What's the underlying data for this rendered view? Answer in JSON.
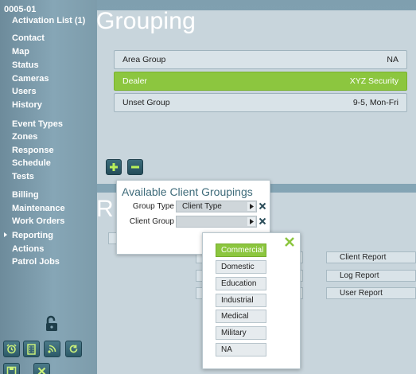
{
  "sidebar": {
    "account_id": "0005-01",
    "items": [
      {
        "label": "Activation List (1)"
      },
      {
        "label": "Contact"
      },
      {
        "label": "Map"
      },
      {
        "label": "Status"
      },
      {
        "label": "Cameras"
      },
      {
        "label": "Users"
      },
      {
        "label": "History"
      },
      {
        "label": "Event Types"
      },
      {
        "label": "Zones"
      },
      {
        "label": "Response"
      },
      {
        "label": "Schedule"
      },
      {
        "label": "Tests"
      },
      {
        "label": "Billing"
      },
      {
        "label": "Maintenance"
      },
      {
        "label": "Work Orders"
      },
      {
        "label": "Reporting"
      },
      {
        "label": "Actions"
      },
      {
        "label": "Patrol Jobs"
      }
    ],
    "active_item": "Reporting"
  },
  "grouping": {
    "title": "Grouping",
    "rows": [
      {
        "name": "Area Group",
        "value": "NA"
      },
      {
        "name": "Dealer",
        "value": "XYZ Security"
      },
      {
        "name": "Unset Group",
        "value": "9-5, Mon-Fri"
      }
    ],
    "selected_row": "Dealer"
  },
  "reports": {
    "title_fragment": "R",
    "buttons": [
      {
        "label": "Client Report"
      },
      {
        "label": "Log Report"
      },
      {
        "label": "User Report"
      }
    ]
  },
  "popup": {
    "title": "Available Client Groupings",
    "group_type_label": "Group Type",
    "group_type_value": "Client Type",
    "client_group_label": "Client Group",
    "client_group_value": ""
  },
  "dropdown": {
    "options": [
      "Commercial",
      "Domestic",
      "Education",
      "Industrial",
      "Medical",
      "Military",
      "NA"
    ],
    "selected": "Commercial"
  },
  "colors": {
    "accent_green": "#8cc63f",
    "panel_bg": "#c8d5dc",
    "sidebar_bg": "#7f9faf"
  }
}
